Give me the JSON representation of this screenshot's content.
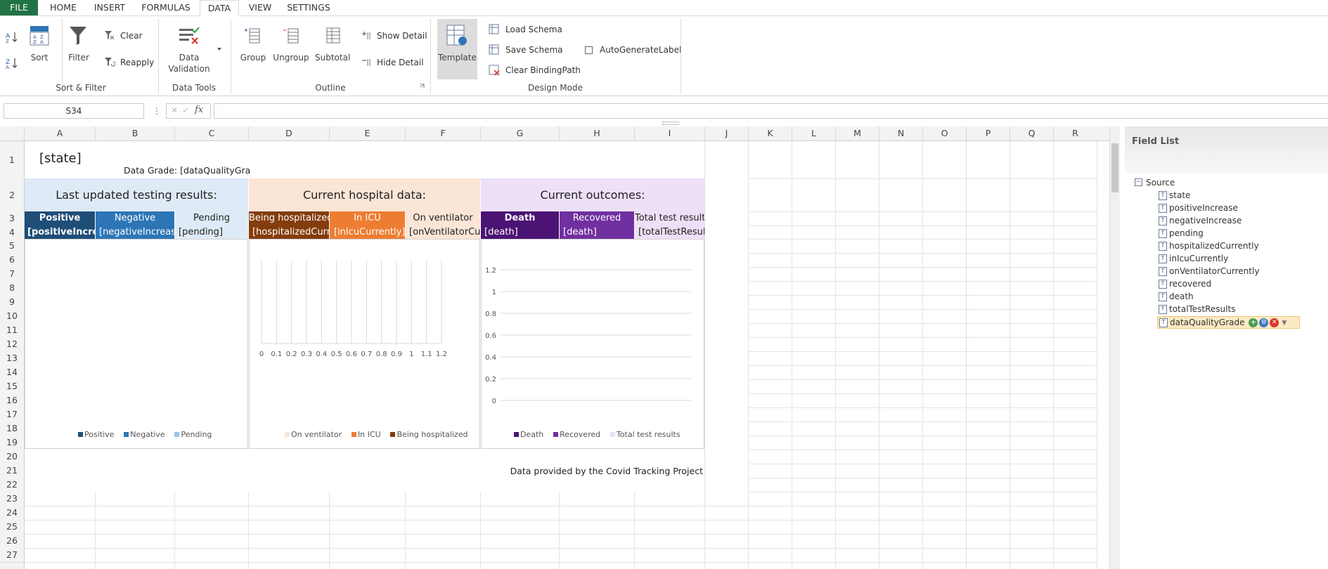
{
  "ribbon_tabs": [
    "FILE",
    "HOME",
    "INSERT",
    "FORMULAS",
    "DATA",
    "VIEW",
    "SETTINGS"
  ],
  "ribbon": {
    "sort_label": "Sort",
    "filter_label": "Filter",
    "clear_label": "Clear",
    "reapply_label": "Reapply",
    "sort_filter_group": "Sort & Filter",
    "data_validation_line1": "Data",
    "data_validation_line2": "Validation",
    "data_tools_group": "Data Tools",
    "group_label": "Group",
    "ungroup_label": "Ungroup",
    "subtotal_label": "Subtotal",
    "show_detail_label": "Show Detail",
    "hide_detail_label": "Hide Detail",
    "outline_group": "Outline",
    "template_label": "Template",
    "load_schema_label": "Load Schema",
    "save_schema_label": "Save Schema",
    "clear_binding_label": "Clear BindingPath",
    "auto_label": "AutoGenerateLabel",
    "design_mode_group": "Design Mode"
  },
  "formula_bar": {
    "name_box": "S34",
    "fx": "fx",
    "value": ""
  },
  "columns": [
    "A",
    "B",
    "C",
    "D",
    "E",
    "F",
    "G",
    "H",
    "I",
    "J",
    "K",
    "L",
    "M",
    "N",
    "O",
    "P",
    "Q",
    "R"
  ],
  "rows": [
    "1",
    "2",
    "3",
    "4",
    "5",
    "6",
    "7",
    "8",
    "9",
    "10",
    "11",
    "12",
    "13",
    "14",
    "15",
    "16",
    "17",
    "18",
    "19",
    "20",
    "21",
    "22",
    "23",
    "24",
    "25",
    "26",
    "27"
  ],
  "sheet": {
    "state": "[state]",
    "grade": "Data Grade: [dataQualityGrad",
    "sec1_title": "Last updated testing results:",
    "sec2_title": "Current hospital data:",
    "sec3_title": "Current outcomes:",
    "h_positive": "Positive",
    "h_negative": "Negative",
    "h_pending": "Pending",
    "h_hosp": "Being hospitalized",
    "h_icu": "In ICU",
    "h_vent": "On ventilator",
    "h_death": "Death",
    "h_recovered": "Recovered",
    "h_total": "Total test results",
    "v_positive": "[positiveIncreas",
    "v_negative": "[negativeIncrease]",
    "v_pending": "[pending]",
    "v_hosp": "[hospitalizedCurre",
    "v_icu": "[inIcuCurrently]",
    "v_vent": "[onVentilatorCur",
    "v_death": "[death]",
    "v_recovered": "[death]",
    "v_total": "[totalTestResults",
    "footer": "Data provided by the Covid Tracking Project"
  },
  "chart1_legend": [
    "Positive",
    "Negative",
    "Pending"
  ],
  "chart2_legend": [
    "On ventilator",
    "In ICU",
    "Being hospitalized"
  ],
  "chart3_legend": [
    "Death",
    "Recovered",
    "Total test results"
  ],
  "chart_data": [
    {
      "type": "bar",
      "categories": [],
      "series": [
        {
          "name": "Positive",
          "values": []
        },
        {
          "name": "Negative",
          "values": []
        },
        {
          "name": "Pending",
          "values": []
        }
      ],
      "legend": "bottom"
    },
    {
      "type": "bar",
      "x_ticks": [
        "0",
        "0.1",
        "0.2",
        "0.3",
        "0.4",
        "0.5",
        "0.6",
        "0.7",
        "0.8",
        "0.9",
        "1",
        "1.1",
        "1.2"
      ],
      "xlim": [
        0,
        1.2
      ],
      "series": [
        {
          "name": "On ventilator",
          "values": []
        },
        {
          "name": "In ICU",
          "values": []
        },
        {
          "name": "Being hospitalized",
          "values": []
        }
      ],
      "grid": "vertical",
      "legend": "bottom"
    },
    {
      "type": "bar",
      "y_ticks": [
        "0",
        "0.2",
        "0.4",
        "0.6",
        "0.8",
        "1",
        "1.2"
      ],
      "ylim": [
        0,
        1.2
      ],
      "series": [
        {
          "name": "Death",
          "values": []
        },
        {
          "name": "Recovered",
          "values": []
        },
        {
          "name": "Total test results",
          "values": []
        }
      ],
      "grid": "horizontal",
      "legend": "bottom"
    }
  ],
  "colors": {
    "positive": "#1f4e79",
    "negative": "#2e75b6",
    "pending_bg": "#deebf7",
    "hosp": "#843c0c",
    "icu": "#ed7d31",
    "vent_bg": "#fbe5d6",
    "death": "#4b1374",
    "recovered": "#7030a0",
    "total_bg": "#ede0f7",
    "sec1_bg": "#deebf7",
    "sec2_bg": "#fbe5d6",
    "sec3_bg": "#ede0f7"
  },
  "field_list": {
    "title": "Field List",
    "root": "Source",
    "fields": [
      "state",
      "positiveIncrease",
      "negativeIncrease",
      "pending",
      "hospitalizedCurrently",
      "inIcuCurrently",
      "onVentilatorCurrently",
      "recovered",
      "death",
      "totalTestResults",
      "dataQualityGrade"
    ],
    "selected": "dataQualityGrade"
  }
}
